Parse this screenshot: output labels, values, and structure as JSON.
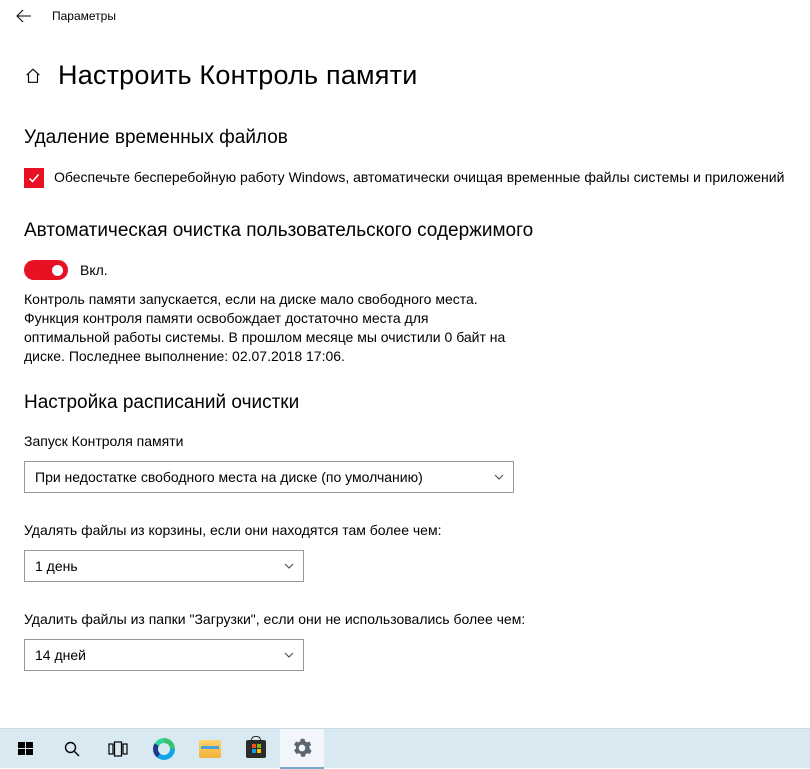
{
  "window": {
    "title": "Параметры"
  },
  "page": {
    "title": "Настроить Контроль памяти"
  },
  "temp_files": {
    "heading": "Удаление временных файлов",
    "checkbox_label": "Обеспечьте бесперебойную работу Windows, автоматически очищая временные файлы системы и приложений"
  },
  "auto_cleanup": {
    "heading": "Автоматическая очистка пользовательского содержимого",
    "toggle_label": "Вкл.",
    "description": "Контроль памяти запускается, если на диске мало свободного места. Функция контроля памяти освобождает достаточно места для оптимальной работы системы. В прошлом месяце мы очистили 0 байт на диске. Последнее выполнение: 02.07.2018 17:06."
  },
  "schedule": {
    "heading": "Настройка расписаний очистки",
    "run_label": "Запуск Контроля памяти",
    "run_value": "При недостатке свободного места на диске (по умолчанию)",
    "recycle_label": "Удалять файлы из корзины, если они находятся там более чем:",
    "recycle_value": "1 день",
    "downloads_label": "Удалить файлы из папки \"Загрузки\", если они не использовались более чем:",
    "downloads_value": "14 дней"
  }
}
